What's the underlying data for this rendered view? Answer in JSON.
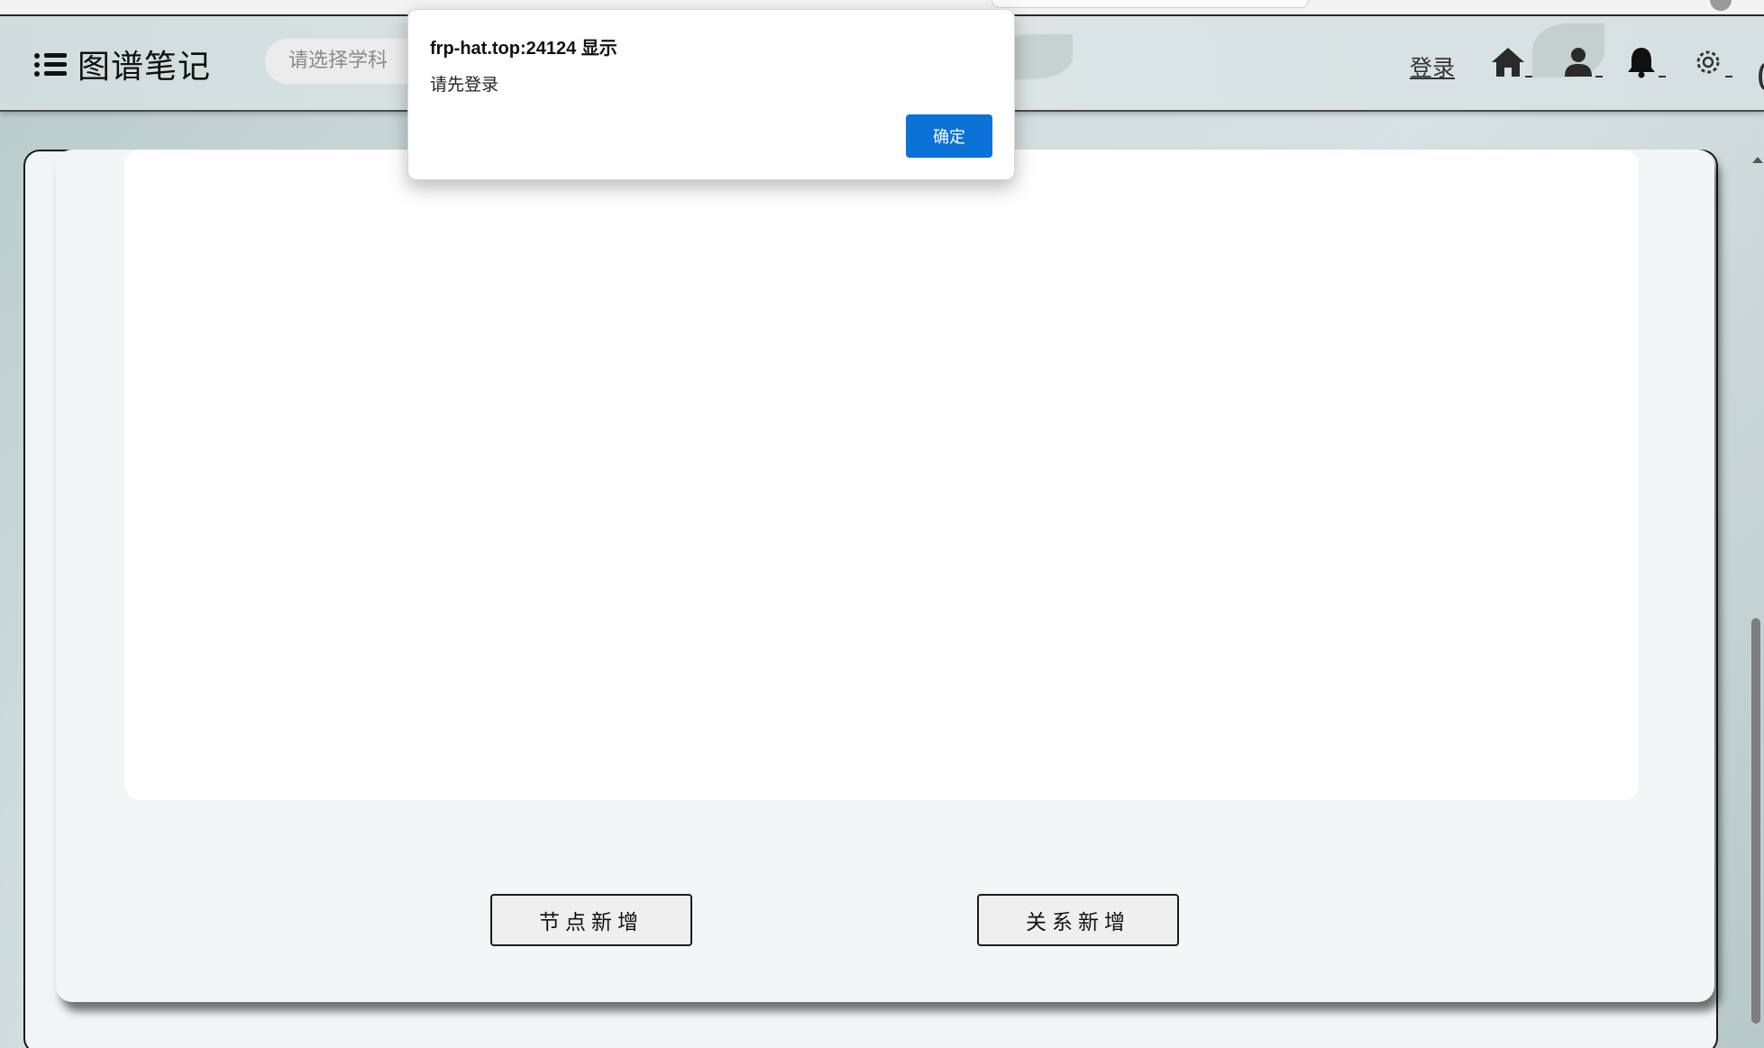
{
  "app": {
    "title": "图谱笔记"
  },
  "header": {
    "subject_placeholder": "请选择学科",
    "login_label": "登录",
    "icons": [
      "home-icon",
      "user-icon",
      "bell-icon",
      "gear-icon"
    ]
  },
  "actions": {
    "add_node_label": "节点新增",
    "add_relation_label": "关系新增"
  },
  "dialog": {
    "title": "frp-hat.top:24124 显示",
    "message": "请先登录",
    "ok_label": "确定"
  },
  "colors": {
    "primary_button": "#0b72d7",
    "header_bg": "#d7e1e1",
    "card_bg": "#f3f6f6"
  }
}
